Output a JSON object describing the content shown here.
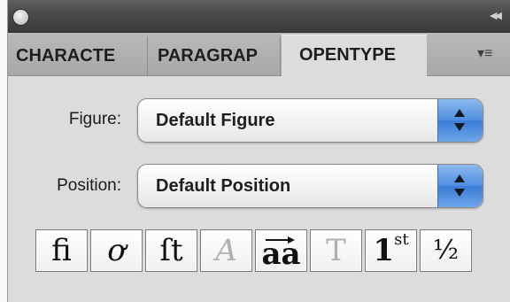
{
  "titlebar": {
    "close_icon": "close-icon",
    "collapse_icon": "collapse-double-chevron-icon",
    "collapse_glyph": "◀◀"
  },
  "tabs": [
    {
      "label": "CHARACTE",
      "active": false
    },
    {
      "label": "PARAGRAP",
      "active": false
    },
    {
      "label": "OPENTYPE",
      "active": true
    }
  ],
  "panel_menu": {
    "icon": "panel-menu-icon",
    "glyph": "▾≡"
  },
  "figure": {
    "label": "Figure:",
    "value": "Default Figure"
  },
  "position": {
    "label": "Position:",
    "value": "Default Position"
  },
  "glyph_buttons": [
    {
      "name": "standard-ligatures",
      "glyph": "fi",
      "enabled": true
    },
    {
      "name": "contextual-alternates",
      "glyph": "ơ",
      "enabled": true
    },
    {
      "name": "discretionary-ligatures",
      "glyph": "ſt",
      "enabled": true
    },
    {
      "name": "swash",
      "glyph": "A",
      "enabled": false
    },
    {
      "name": "stylistic-alternates",
      "glyph": "aa",
      "enabled": true
    },
    {
      "name": "titling-alternates",
      "glyph": "T",
      "enabled": false
    },
    {
      "name": "ordinals",
      "glyph": "1",
      "sup": "st",
      "enabled": true
    },
    {
      "name": "fractions",
      "glyph": "½",
      "enabled": true
    }
  ],
  "colors": {
    "panel_bg": "#dcdcdc",
    "titlebar": "#4a4a4a",
    "stepper_accent": "#4f8ee0"
  }
}
